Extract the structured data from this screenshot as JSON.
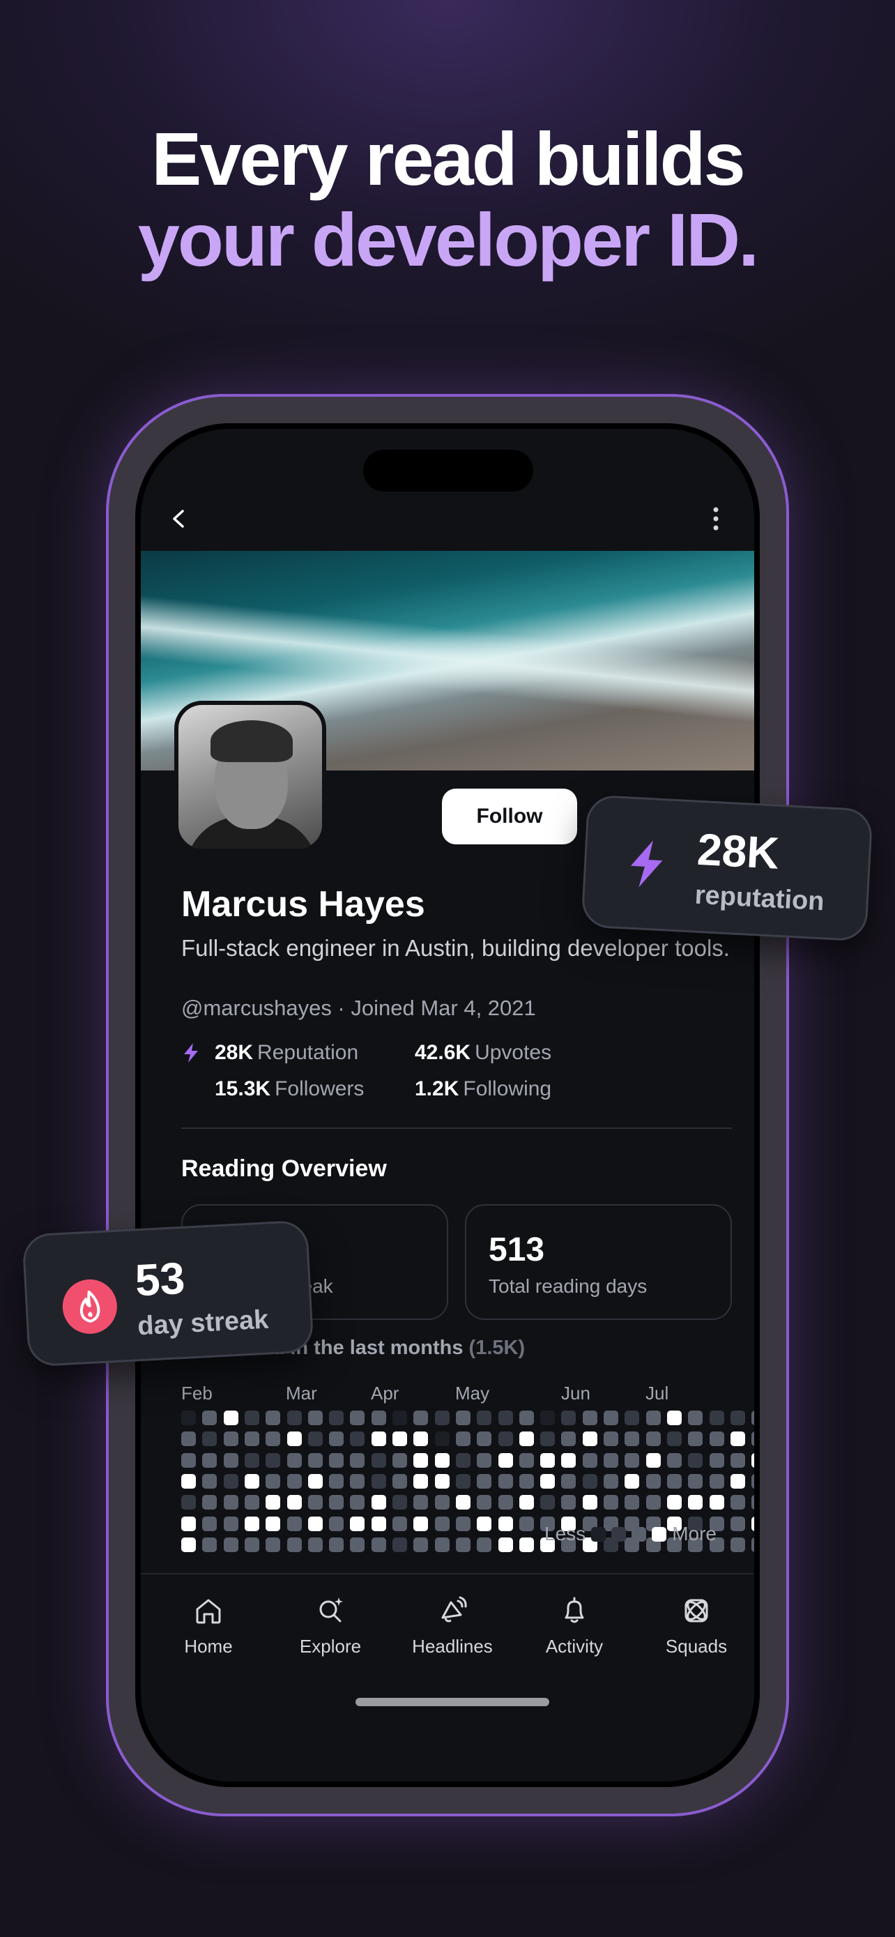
{
  "headline": {
    "line1": "Every read builds",
    "line2": "your developer ID."
  },
  "profile": {
    "follow_label": "Follow",
    "name": "Marcus Hayes",
    "bio": "Full-stack engineer in Austin, building developer tools.",
    "handle_line": "@marcushayes · Joined Mar 4, 2021",
    "stats": {
      "reputation_value": "28K",
      "reputation_label": "Reputation",
      "upvotes_value": "42.6K",
      "upvotes_label": "Upvotes",
      "followers_value": "15.3K",
      "followers_label": "Followers",
      "following_value": "1.2K",
      "following_label": "Following"
    }
  },
  "reading": {
    "title": "Reading Overview",
    "streak_value": "53",
    "streak_label": "Longest streak",
    "days_value": "513",
    "days_label": "Total reading days",
    "posts_title": "Posts read in the last months",
    "posts_count": "(1.5K)",
    "months": [
      "Feb",
      "Mar",
      "Apr",
      "May",
      "Jun",
      "Jul"
    ],
    "legend_less": "Less",
    "legend_more": "More",
    "levels": [
      "#1c1f26",
      "#353944",
      "#5b606d",
      "#ffffff"
    ],
    "heatmap": [
      [
        0,
        2,
        3,
        1,
        2,
        1,
        2,
        1,
        2,
        2,
        0,
        2,
        1,
        2,
        1,
        1,
        2,
        0,
        1,
        2,
        2,
        1,
        2,
        3,
        2,
        1,
        1,
        2,
        0,
        2,
        1,
        2,
        3,
        3,
        3,
        3
      ],
      [
        2,
        1,
        2,
        2,
        2,
        3,
        1,
        2,
        1,
        3,
        3,
        3,
        0,
        2,
        2,
        1,
        3,
        1,
        2,
        3,
        2,
        2,
        2,
        1,
        2,
        2,
        3,
        2,
        2,
        2,
        1,
        2,
        3,
        2,
        3,
        3
      ],
      [
        2,
        2,
        2,
        1,
        1,
        2,
        2,
        2,
        2,
        1,
        2,
        3,
        3,
        1,
        2,
        3,
        2,
        3,
        3,
        2,
        2,
        2,
        3,
        2,
        1,
        2,
        2,
        3,
        1,
        2,
        1,
        2,
        2,
        3,
        2,
        2
      ],
      [
        3,
        2,
        1,
        3,
        2,
        2,
        3,
        2,
        2,
        1,
        2,
        3,
        3,
        1,
        2,
        2,
        2,
        3,
        2,
        1,
        2,
        3,
        2,
        2,
        2,
        2,
        3,
        2,
        1,
        2,
        2,
        3,
        3,
        3,
        2,
        3
      ],
      [
        1,
        2,
        2,
        2,
        3,
        3,
        2,
        2,
        2,
        3,
        1,
        2,
        2,
        3,
        2,
        2,
        3,
        1,
        2,
        3,
        2,
        2,
        2,
        3,
        3,
        3,
        2,
        2,
        2,
        3,
        3,
        3,
        2,
        2,
        3,
        2
      ],
      [
        3,
        2,
        2,
        3,
        3,
        2,
        3,
        2,
        3,
        3,
        2,
        3,
        2,
        2,
        3,
        3,
        2,
        2,
        3,
        2,
        2,
        2,
        2,
        3,
        1,
        2,
        2,
        3,
        2,
        2,
        3,
        2,
        3,
        3,
        2,
        3
      ],
      [
        3,
        2,
        2,
        2,
        2,
        2,
        2,
        2,
        2,
        2,
        1,
        2,
        2,
        2,
        2,
        3,
        3,
        3,
        2,
        3,
        1,
        2,
        2,
        2,
        2,
        2,
        2,
        2,
        2,
        2,
        2,
        2,
        2,
        3,
        2,
        3
      ]
    ]
  },
  "tabs": [
    {
      "label": "Home",
      "icon": "home-icon"
    },
    {
      "label": "Explore",
      "icon": "explore-icon"
    },
    {
      "label": "Headlines",
      "icon": "headlines-icon"
    },
    {
      "label": "Activity",
      "icon": "bell-icon"
    },
    {
      "label": "Squads",
      "icon": "squads-icon"
    }
  ],
  "badges": {
    "reputation_value": "28K",
    "reputation_label": "reputation",
    "streak_value": "53",
    "streak_label": "day streak"
  },
  "colors": {
    "accent": "#c9a6f5",
    "bolt": "#a66bf2",
    "fire": "#f0506e",
    "frame": "#8a5ccf"
  }
}
